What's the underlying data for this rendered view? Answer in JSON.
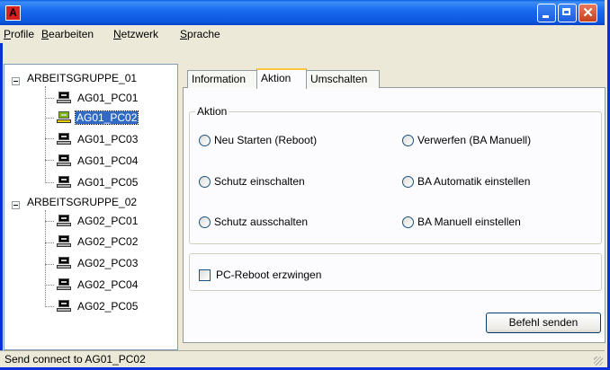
{
  "window": {
    "icon_letter": "A",
    "colors": {
      "titlebar": "#0A5FE0",
      "selection": "#316AC5",
      "active_tab_accent": "#FFC83C"
    }
  },
  "menubar": {
    "items": [
      "Profile",
      "Bearbeiten",
      "Netzwerk",
      "Sprache"
    ]
  },
  "tree": {
    "groups": [
      {
        "label": "ARBEITSGRUPPE_01",
        "expander": "minus",
        "items": [
          "AG01_PC01",
          "AG01_PC02",
          "AG01_PC03",
          "AG01_PC04",
          "AG01_PC05"
        ]
      },
      {
        "label": "ARBEITSGRUPPE_02",
        "expander": "minus",
        "items": [
          "AG02_PC01",
          "AG02_PC02",
          "AG02_PC03",
          "AG02_PC04",
          "AG02_PC05"
        ]
      }
    ],
    "selected_item": "AG01_PC02",
    "icon": "computer-icon"
  },
  "tabs": {
    "items": [
      "Information",
      "Aktion",
      "Umschalten"
    ],
    "active": "Aktion"
  },
  "aktion": {
    "groupbox_label": "Aktion",
    "radios": [
      "Neu Starten (Reboot)",
      "Verwerfen (BA Manuell)",
      "Schutz einschalten",
      "BA Automatik einstellen",
      "Schutz ausschalten",
      "BA Manuell  einstellen"
    ],
    "checkbox_label": "PC-Reboot erzwingen",
    "checkbox_checked": false,
    "send_button": "Befehl senden"
  },
  "statusbar": {
    "text": "Send connect to AG01_PC02"
  }
}
